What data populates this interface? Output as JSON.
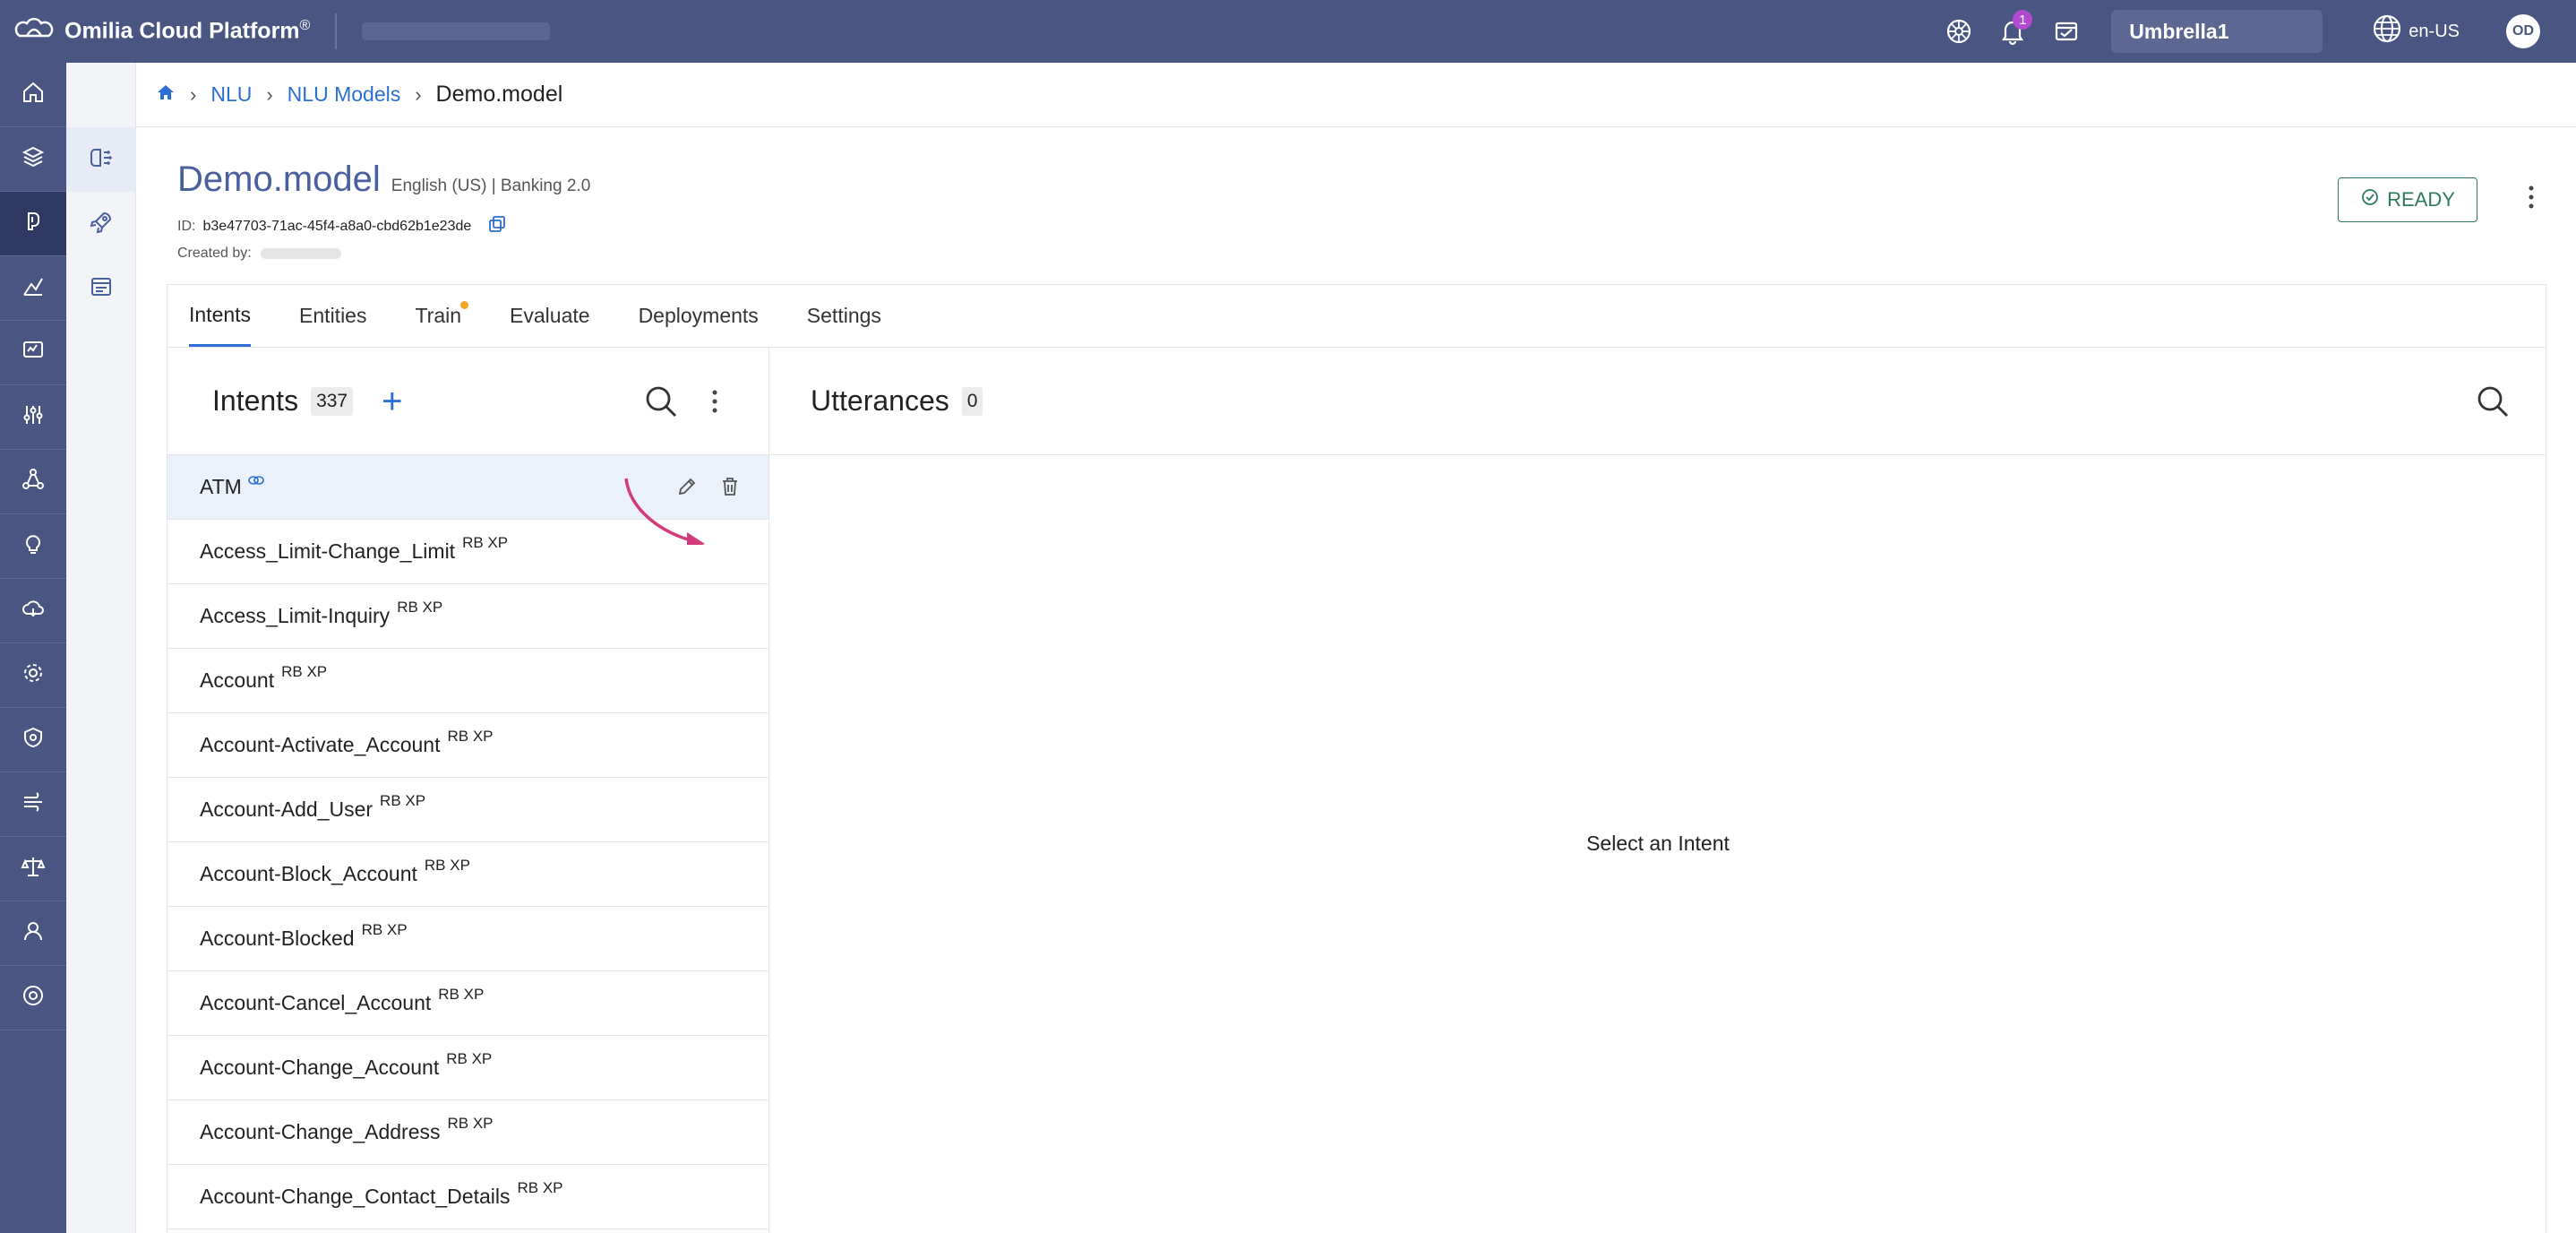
{
  "topbar": {
    "brand": "Omilia Cloud Platform",
    "brand_mark": "®",
    "notification_count": "1",
    "org": "Umbrella1",
    "language": "en-US",
    "avatar_initials": "OD"
  },
  "breadcrumb": {
    "items": [
      "NLU",
      "NLU Models"
    ],
    "current": "Demo.model"
  },
  "model": {
    "title": "Demo.model",
    "meta": "English (US) | Banking 2.0",
    "id_label": "ID:",
    "id_value": "b3e47703-71ac-45f4-a8a0-cbd62b1e23de",
    "created_label": "Created by:",
    "status": "READY"
  },
  "tabs": [
    "Intents",
    "Entities",
    "Train",
    "Evaluate",
    "Deployments",
    "Settings"
  ],
  "intents": {
    "title": "Intents",
    "count": "337",
    "add_label": "+",
    "items": [
      {
        "name": "ATM",
        "tag": ""
      },
      {
        "name": "Access_Limit-Change_Limit",
        "tag": "RB XP"
      },
      {
        "name": "Access_Limit-Inquiry",
        "tag": "RB XP"
      },
      {
        "name": "Account",
        "tag": "RB XP"
      },
      {
        "name": "Account-Activate_Account",
        "tag": "RB XP"
      },
      {
        "name": "Account-Add_User",
        "tag": "RB XP"
      },
      {
        "name": "Account-Block_Account",
        "tag": "RB XP"
      },
      {
        "name": "Account-Blocked",
        "tag": "RB XP"
      },
      {
        "name": "Account-Cancel_Account",
        "tag": "RB XP"
      },
      {
        "name": "Account-Change_Account",
        "tag": "RB XP"
      },
      {
        "name": "Account-Change_Address",
        "tag": "RB XP"
      },
      {
        "name": "Account-Change_Contact_Details",
        "tag": "RB XP"
      }
    ]
  },
  "utterances": {
    "title": "Utterances",
    "count": "0",
    "empty_message": "Select an Intent"
  },
  "colors": {
    "nav_bg": "#4a5682",
    "accent": "#2b6fd6",
    "ready": "#2d7a5a",
    "arrow": "#d23c7a"
  }
}
